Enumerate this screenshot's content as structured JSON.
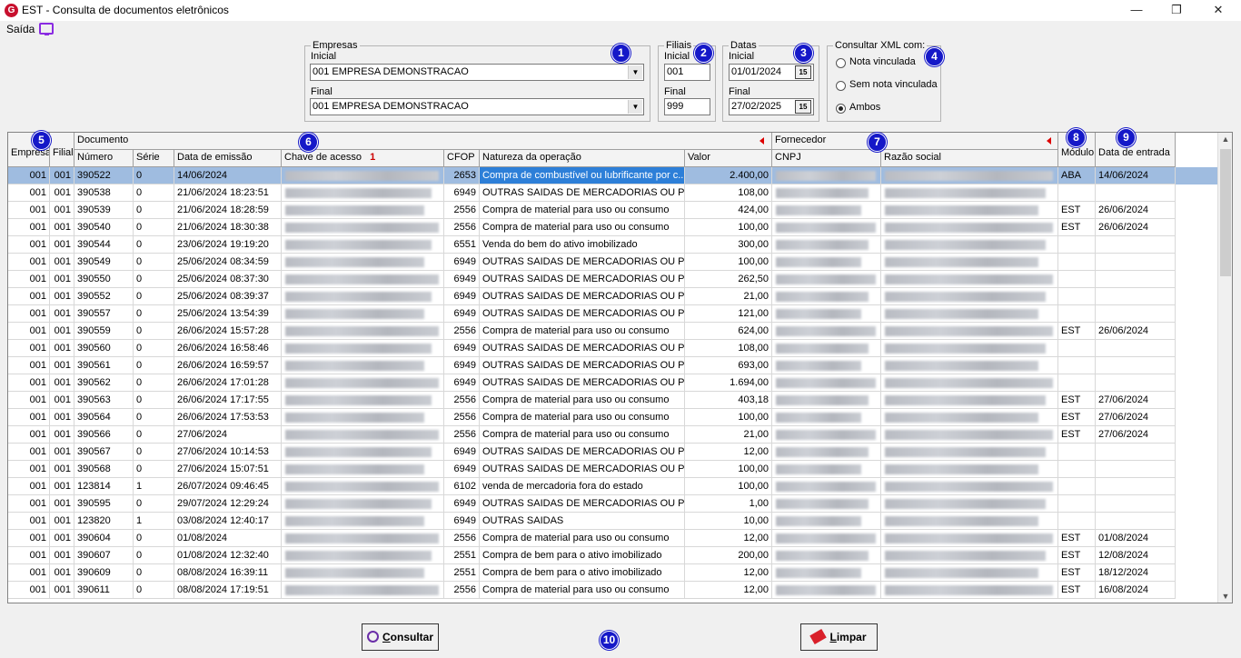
{
  "window": {
    "title": "EST - Consulta de documentos eletrônicos",
    "logo_letter": "G",
    "minimize": "—",
    "restore": "❐",
    "close": "✕"
  },
  "menu": {
    "saida": "Saída",
    "icon": "monitor-icon"
  },
  "empresas": {
    "legend": "Empresas",
    "inicial_label": "Inicial",
    "inicial_value": "001 EMPRESA DEMONSTRACAO",
    "final_label": "Final",
    "final_value": "001 EMPRESA DEMONSTRACAO"
  },
  "filiais": {
    "legend": "Filiais",
    "inicial_label": "Inicial",
    "inicial_value": "001",
    "final_label": "Final",
    "final_value": "999"
  },
  "datas": {
    "legend": "Datas",
    "inicial_label": "Inicial",
    "inicial_value": "01/01/2024",
    "final_label": "Final",
    "final_value": "27/02/2025",
    "calendar_label": "15"
  },
  "xml": {
    "legend": "Consultar XML com:",
    "options": [
      "Nota vinculada",
      "Sem nota vinculada",
      "Ambos"
    ],
    "selected": "Ambos"
  },
  "badges": [
    "1",
    "2",
    "3",
    "4",
    "5",
    "6",
    "7",
    "8",
    "9",
    "10"
  ],
  "grid": {
    "group_documento": "Documento",
    "group_fornecedor": "Fornecedor",
    "columns": {
      "empresa": "Empresa",
      "filial": "Filial",
      "numero": "Número",
      "serie": "Série",
      "data_emissao": "Data de emissão",
      "chave": "Chave de acesso",
      "chave_sort": "1",
      "cfop": "CFOP",
      "natureza": "Natureza da operação",
      "valor": "Valor",
      "cnpj": "CNPJ",
      "razao": "Razão social",
      "modulo": "Módulo",
      "entrada": "Data de entrada"
    },
    "rows": [
      {
        "empresa": "001",
        "filial": "001",
        "numero": "390522",
        "serie": "0",
        "data": "14/06/2024",
        "cfop": "2653",
        "natureza": "Compra de combustível ou lubrificante por c...",
        "valor": "2.400,00",
        "modulo": "ABA",
        "entrada": "14/06/2024"
      },
      {
        "empresa": "001",
        "filial": "001",
        "numero": "390538",
        "serie": "0",
        "data": "21/06/2024 18:23:51",
        "cfop": "6949",
        "natureza": "OUTRAS SAIDAS DE MERCADORIAS OU PR...",
        "valor": "108,00",
        "modulo": "",
        "entrada": ""
      },
      {
        "empresa": "001",
        "filial": "001",
        "numero": "390539",
        "serie": "0",
        "data": "21/06/2024 18:28:59",
        "cfop": "2556",
        "natureza": "Compra de material para uso ou consumo",
        "valor": "424,00",
        "modulo": "EST",
        "entrada": "26/06/2024"
      },
      {
        "empresa": "001",
        "filial": "001",
        "numero": "390540",
        "serie": "0",
        "data": "21/06/2024 18:30:38",
        "cfop": "2556",
        "natureza": "Compra de material para uso ou consumo",
        "valor": "100,00",
        "modulo": "EST",
        "entrada": "26/06/2024"
      },
      {
        "empresa": "001",
        "filial": "001",
        "numero": "390544",
        "serie": "0",
        "data": "23/06/2024 19:19:20",
        "cfop": "6551",
        "natureza": "Venda do bem do ativo imobilizado",
        "valor": "300,00",
        "modulo": "",
        "entrada": ""
      },
      {
        "empresa": "001",
        "filial": "001",
        "numero": "390549",
        "serie": "0",
        "data": "25/06/2024 08:34:59",
        "cfop": "6949",
        "natureza": "OUTRAS SAIDAS DE MERCADORIAS OU PR...",
        "valor": "100,00",
        "modulo": "",
        "entrada": ""
      },
      {
        "empresa": "001",
        "filial": "001",
        "numero": "390550",
        "serie": "0",
        "data": "25/06/2024 08:37:30",
        "cfop": "6949",
        "natureza": "OUTRAS SAIDAS DE MERCADORIAS OU PR...",
        "valor": "262,50",
        "modulo": "",
        "entrada": ""
      },
      {
        "empresa": "001",
        "filial": "001",
        "numero": "390552",
        "serie": "0",
        "data": "25/06/2024 08:39:37",
        "cfop": "6949",
        "natureza": "OUTRAS SAIDAS DE MERCADORIAS OU PR...",
        "valor": "21,00",
        "modulo": "",
        "entrada": ""
      },
      {
        "empresa": "001",
        "filial": "001",
        "numero": "390557",
        "serie": "0",
        "data": "25/06/2024 13:54:39",
        "cfop": "6949",
        "natureza": "OUTRAS SAIDAS DE MERCADORIAS OU PR...",
        "valor": "121,00",
        "modulo": "",
        "entrada": ""
      },
      {
        "empresa": "001",
        "filial": "001",
        "numero": "390559",
        "serie": "0",
        "data": "26/06/2024 15:57:28",
        "cfop": "2556",
        "natureza": "Compra de material para uso ou consumo",
        "valor": "624,00",
        "modulo": "EST",
        "entrada": "26/06/2024"
      },
      {
        "empresa": "001",
        "filial": "001",
        "numero": "390560",
        "serie": "0",
        "data": "26/06/2024 16:58:46",
        "cfop": "6949",
        "natureza": "OUTRAS SAIDAS DE MERCADORIAS OU PR...",
        "valor": "108,00",
        "modulo": "",
        "entrada": ""
      },
      {
        "empresa": "001",
        "filial": "001",
        "numero": "390561",
        "serie": "0",
        "data": "26/06/2024 16:59:57",
        "cfop": "6949",
        "natureza": "OUTRAS SAIDAS DE MERCADORIAS OU PR...",
        "valor": "693,00",
        "modulo": "",
        "entrada": ""
      },
      {
        "empresa": "001",
        "filial": "001",
        "numero": "390562",
        "serie": "0",
        "data": "26/06/2024 17:01:28",
        "cfop": "6949",
        "natureza": "OUTRAS SAIDAS DE MERCADORIAS OU PR...",
        "valor": "1.694,00",
        "modulo": "",
        "entrada": ""
      },
      {
        "empresa": "001",
        "filial": "001",
        "numero": "390563",
        "serie": "0",
        "data": "26/06/2024 17:17:55",
        "cfop": "2556",
        "natureza": "Compra de material para uso ou consumo",
        "valor": "403,18",
        "modulo": "EST",
        "entrada": "27/06/2024"
      },
      {
        "empresa": "001",
        "filial": "001",
        "numero": "390564",
        "serie": "0",
        "data": "26/06/2024 17:53:53",
        "cfop": "2556",
        "natureza": "Compra de material para uso ou consumo",
        "valor": "100,00",
        "modulo": "EST",
        "entrada": "27/06/2024"
      },
      {
        "empresa": "001",
        "filial": "001",
        "numero": "390566",
        "serie": "0",
        "data": "27/06/2024",
        "cfop": "2556",
        "natureza": "Compra de material para uso ou consumo",
        "valor": "21,00",
        "modulo": "EST",
        "entrada": "27/06/2024"
      },
      {
        "empresa": "001",
        "filial": "001",
        "numero": "390567",
        "serie": "0",
        "data": "27/06/2024 10:14:53",
        "cfop": "6949",
        "natureza": "OUTRAS SAIDAS DE MERCADORIAS OU PR...",
        "valor": "12,00",
        "modulo": "",
        "entrada": ""
      },
      {
        "empresa": "001",
        "filial": "001",
        "numero": "390568",
        "serie": "0",
        "data": "27/06/2024 15:07:51",
        "cfop": "6949",
        "natureza": "OUTRAS SAIDAS DE MERCADORIAS OU PR...",
        "valor": "100,00",
        "modulo": "",
        "entrada": ""
      },
      {
        "empresa": "001",
        "filial": "001",
        "numero": "123814",
        "serie": "1",
        "data": "26/07/2024 09:46:45",
        "cfop": "6102",
        "natureza": "venda de mercadoria fora do estado",
        "valor": "100,00",
        "modulo": "",
        "entrada": ""
      },
      {
        "empresa": "001",
        "filial": "001",
        "numero": "390595",
        "serie": "0",
        "data": "29/07/2024 12:29:24",
        "cfop": "6949",
        "natureza": "OUTRAS SAIDAS DE MERCADORIAS OU PR...",
        "valor": "1,00",
        "modulo": "",
        "entrada": ""
      },
      {
        "empresa": "001",
        "filial": "001",
        "numero": "123820",
        "serie": "1",
        "data": "03/08/2024 12:40:17",
        "cfop": "6949",
        "natureza": "OUTRAS SAIDAS",
        "valor": "10,00",
        "modulo": "",
        "entrada": ""
      },
      {
        "empresa": "001",
        "filial": "001",
        "numero": "390604",
        "serie": "0",
        "data": "01/08/2024",
        "cfop": "2556",
        "natureza": "Compra de material para uso ou consumo",
        "valor": "12,00",
        "modulo": "EST",
        "entrada": "01/08/2024"
      },
      {
        "empresa": "001",
        "filial": "001",
        "numero": "390607",
        "serie": "0",
        "data": "01/08/2024 12:32:40",
        "cfop": "2551",
        "natureza": "Compra de bem para o ativo imobilizado",
        "valor": "200,00",
        "modulo": "EST",
        "entrada": "12/08/2024"
      },
      {
        "empresa": "001",
        "filial": "001",
        "numero": "390609",
        "serie": "0",
        "data": "08/08/2024 16:39:11",
        "cfop": "2551",
        "natureza": "Compra de bem para o ativo imobilizado",
        "valor": "12,00",
        "modulo": "EST",
        "entrada": "18/12/2024"
      },
      {
        "empresa": "001",
        "filial": "001",
        "numero": "390611",
        "serie": "0",
        "data": "08/08/2024 17:19:51",
        "cfop": "2556",
        "natureza": "Compra de material para uso ou consumo",
        "valor": "12,00",
        "modulo": "EST",
        "entrada": "16/08/2024"
      }
    ]
  },
  "buttons": {
    "consultar_underline": "C",
    "consultar_rest": "onsultar",
    "limpar_underline": "L",
    "limpar_rest": "impar"
  },
  "colors": {
    "badge": "#1518c8",
    "selection": "#9fbce0",
    "highlight": "#2d7fd8"
  }
}
